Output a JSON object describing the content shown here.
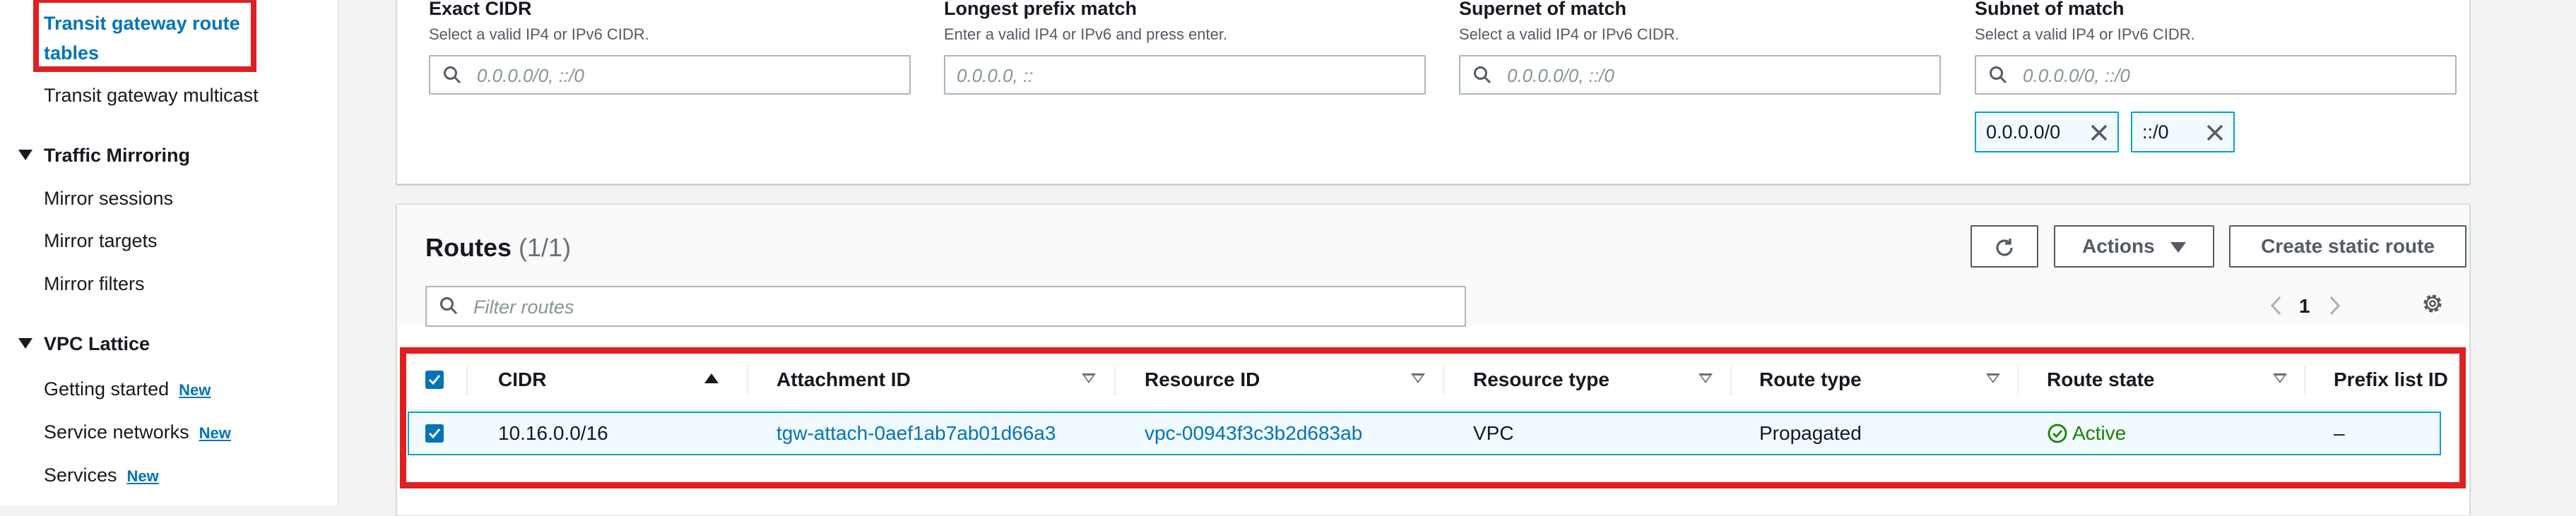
{
  "sidebar": {
    "active_item": "Transit gateway route tables",
    "items": [
      {
        "label": "Transit gateway multicast"
      }
    ],
    "sections": [
      {
        "title": "Traffic Mirroring",
        "items": [
          {
            "label": "Mirror sessions"
          },
          {
            "label": "Mirror targets"
          },
          {
            "label": "Mirror filters"
          }
        ]
      },
      {
        "title": "VPC Lattice",
        "items": [
          {
            "label": "Getting started",
            "badge": "New"
          },
          {
            "label": "Service networks",
            "badge": "New"
          },
          {
            "label": "Services",
            "badge": "New"
          }
        ]
      }
    ]
  },
  "filters": {
    "exact_cidr": {
      "label": "Exact CIDR",
      "description": "Select a valid IP4 or IPv6 CIDR.",
      "placeholder": "0.0.0.0/0, ::/0"
    },
    "longest_prefix": {
      "label": "Longest prefix match",
      "description": "Enter a valid IP4 or IPv6 and press enter.",
      "placeholder": "0.0.0.0, ::"
    },
    "supernet": {
      "label": "Supernet of match",
      "description": "Select a valid IP4 or IPv6 CIDR.",
      "placeholder": "0.0.0.0/0, ::/0"
    },
    "subnet": {
      "label": "Subnet of match",
      "description": "Select a valid IP4 or IPv6 CIDR.",
      "placeholder": "0.0.0.0/0, ::/0",
      "tokens": [
        "0.0.0.0/0",
        "::/0"
      ]
    }
  },
  "routes": {
    "title": "Routes",
    "count": "(1/1)",
    "actions_label": "Actions",
    "create_label": "Create static route",
    "filter_placeholder": "Filter routes",
    "page": "1",
    "columns": [
      "CIDR",
      "Attachment ID",
      "Resource ID",
      "Resource type",
      "Route type",
      "Route state",
      "Prefix list ID"
    ],
    "rows": [
      {
        "cidr": "10.16.0.0/16",
        "attachment_id": "tgw-attach-0aef1ab7ab01d66a3",
        "resource_id": "vpc-00943f3c3b2d683ab",
        "resource_type": "VPC",
        "route_type": "Propagated",
        "route_state": "Active",
        "prefix_list_id": "–"
      }
    ]
  },
  "colors": {
    "link": "#0073bb",
    "highlight": "#e02020",
    "success": "#1d8102",
    "selected_row": "#f1faff"
  }
}
